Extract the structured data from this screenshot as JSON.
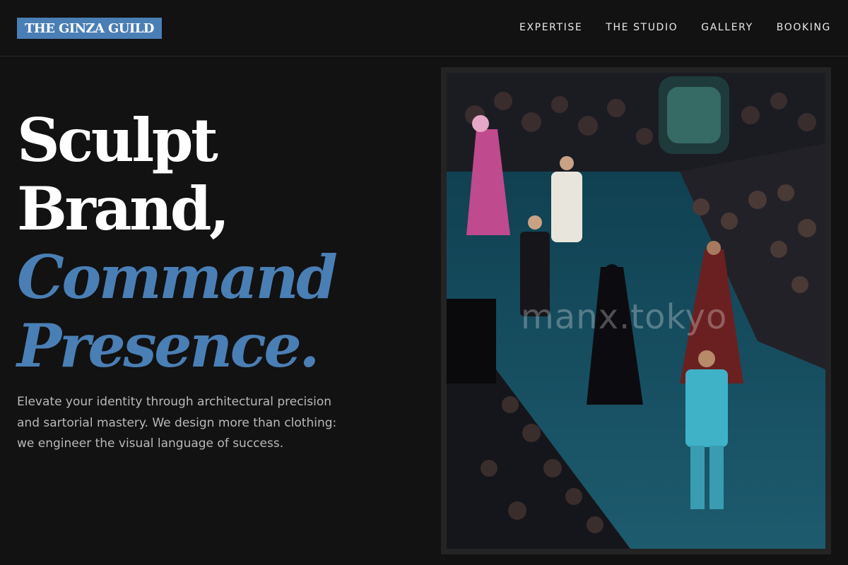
{
  "brand": {
    "logo_text": "THE GINZA GUILD",
    "accent_color": "#4a7fb5"
  },
  "nav": {
    "items": [
      {
        "label": "EXPERTISE"
      },
      {
        "label": "THE STUDIO"
      },
      {
        "label": "GALLERY"
      },
      {
        "label": "BOOKING"
      }
    ]
  },
  "hero": {
    "title_lines": [
      "Sculpt",
      "Brand,",
      "Command",
      "Presence."
    ],
    "description": "Elevate your identity through architectural precision and sartorial mastery. We design more than clothing: we engineer the visual language of success."
  },
  "image": {
    "watermark": "manx.tokyo",
    "subject": "runway fashion show photo"
  }
}
